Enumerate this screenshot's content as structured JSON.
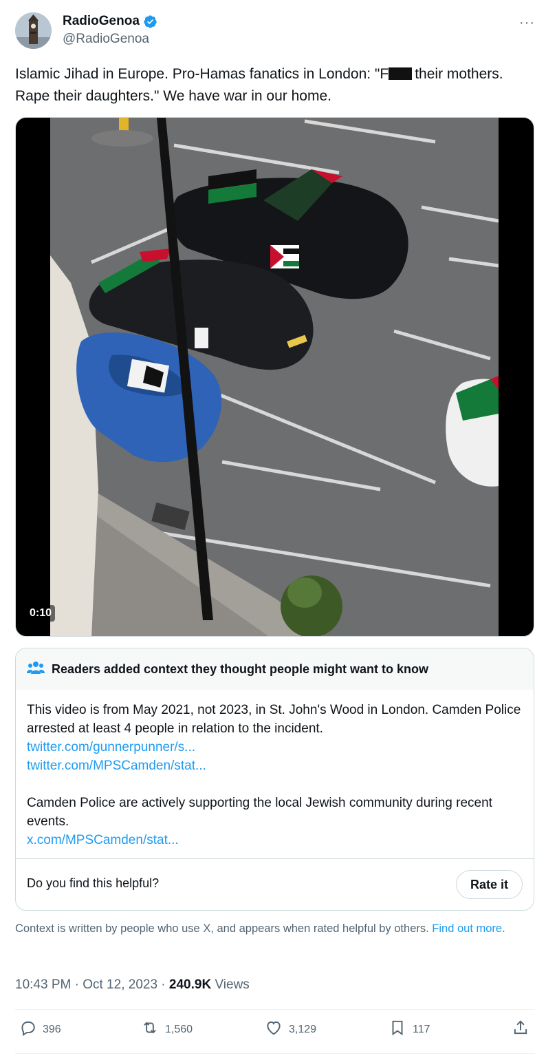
{
  "author": {
    "display_name": "RadioGenoa",
    "handle": "@RadioGenoa",
    "verified": true
  },
  "more_label": "···",
  "tweet": {
    "text_part1": "Islamic Jihad in Europe. Pro-Hamas fanatics in London: \"F",
    "text_part2": "their mothers. Rape their daughters.\" We have war in our home."
  },
  "media": {
    "duration": "0:10"
  },
  "community_note": {
    "title": "Readers added context they thought people might want to know",
    "paragraph1": "This video is from May 2021, not 2023, in St. John's Wood in London. Camden Police arrested at least 4 people in relation to the incident.",
    "link1": "twitter.com/gunnerpunner/s...",
    "link2": "twitter.com/MPSCamden/stat...",
    "paragraph2": "Camden Police are actively supporting the local Jewish community during recent events.",
    "link3": "x.com/MPSCamden/stat...",
    "helpful_question": "Do you find this helpful?",
    "rate_label": "Rate it"
  },
  "context_footer": {
    "text": "Context is written by people who use X, and appears when rated helpful by others.",
    "link": "Find out more",
    "end": "."
  },
  "meta": {
    "time": "10:43 PM",
    "separator": "·",
    "date": "Oct 12, 2023",
    "views_count": "240.9K",
    "views_label": "Views"
  },
  "actions": {
    "replies": "396",
    "reposts": "1,560",
    "likes": "3,129",
    "bookmarks": "117"
  },
  "colors": {
    "accent": "#1d9bf0",
    "text": "#0f1419",
    "muted": "#536471",
    "border": "#cfd9de"
  }
}
